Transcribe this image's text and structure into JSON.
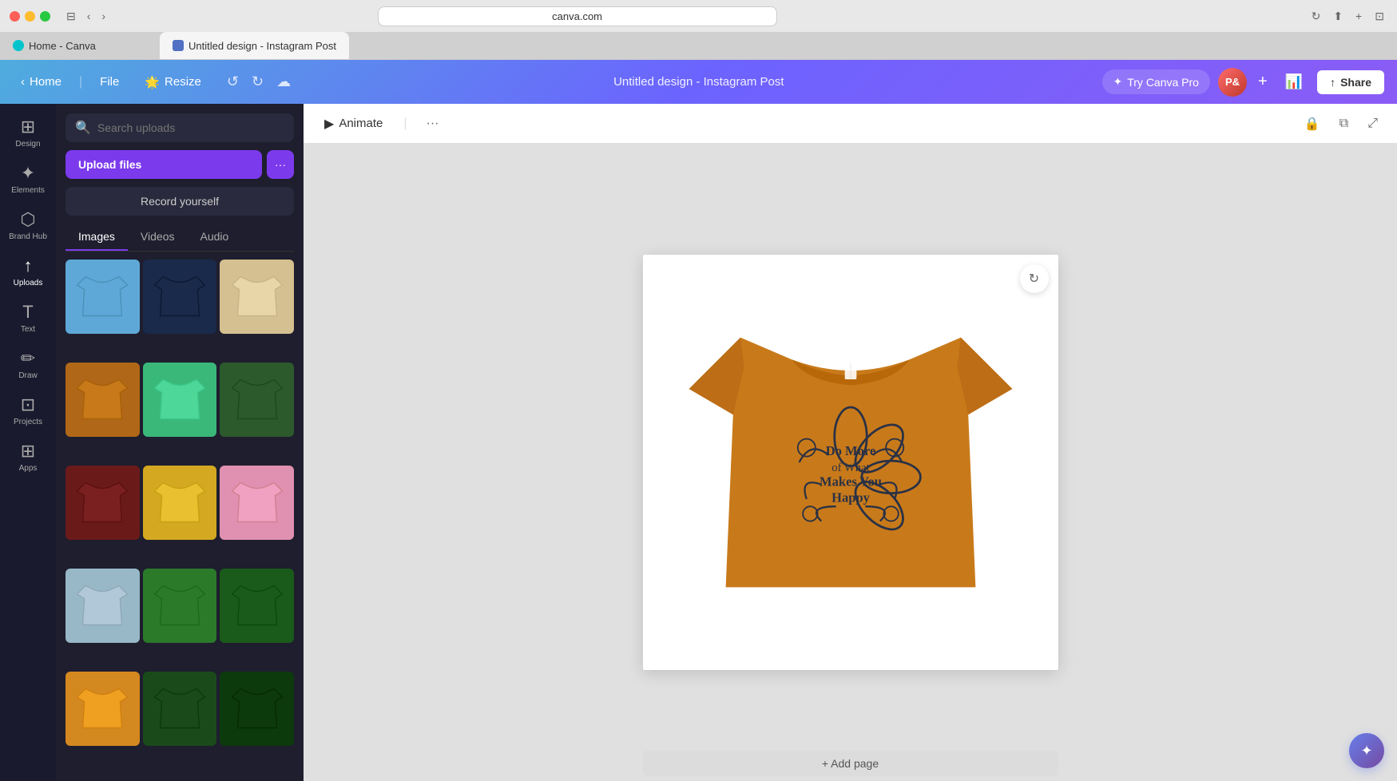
{
  "browser": {
    "url": "canva.com",
    "tabs": [
      {
        "label": "Home - Canva",
        "favicon_type": "canva-home",
        "active": false
      },
      {
        "label": "Untitled design - Instagram Post",
        "favicon_type": "canva-design",
        "active": true
      }
    ]
  },
  "nav": {
    "home_label": "Home",
    "file_label": "File",
    "resize_label": "Resize",
    "title": "Untitled design - Instagram Post",
    "try_pro_label": "Try Canva Pro",
    "avatar_label": "P&",
    "share_label": "Share"
  },
  "sidebar": {
    "items": [
      {
        "id": "design",
        "label": "Design",
        "icon": "⊞"
      },
      {
        "id": "elements",
        "label": "Elements",
        "icon": "✦"
      },
      {
        "id": "brand-hub",
        "label": "Brand Hub",
        "icon": "⬡"
      },
      {
        "id": "uploads",
        "label": "Uploads",
        "icon": "↑"
      },
      {
        "id": "text",
        "label": "Text",
        "icon": "T"
      },
      {
        "id": "draw",
        "label": "Draw",
        "icon": "✏"
      },
      {
        "id": "projects",
        "label": "Projects",
        "icon": "⊡"
      },
      {
        "id": "apps",
        "label": "Apps",
        "icon": "⊞"
      }
    ]
  },
  "uploads_panel": {
    "search_placeholder": "Search uploads",
    "upload_files_label": "Upload files",
    "upload_more_icon": "···",
    "record_label": "Record yourself",
    "tabs": [
      {
        "id": "images",
        "label": "Images",
        "active": true
      },
      {
        "id": "videos",
        "label": "Videos",
        "active": false
      },
      {
        "id": "audio",
        "label": "Audio",
        "active": false
      }
    ],
    "thumbnails": [
      {
        "color": "#5ea8d8",
        "label": "light-blue-tshirt"
      },
      {
        "color": "#1a2a4a",
        "label": "dark-navy-tshirt"
      },
      {
        "color": "#e8d5a8",
        "label": "beige-tshirt"
      },
      {
        "color": "#c87a1a",
        "label": "amber-tshirt"
      },
      {
        "color": "#4dd89a",
        "label": "mint-tshirt"
      },
      {
        "color": "#2d5a2d",
        "label": "dark-green-tshirt"
      },
      {
        "color": "#6b1a1a",
        "label": "maroon-tshirt"
      },
      {
        "color": "#f5c842",
        "label": "yellow-tshirt"
      },
      {
        "color": "#f0a0c0",
        "label": "pink-tshirt"
      },
      {
        "color": "#b0c8d8",
        "label": "light-blue2-tshirt"
      },
      {
        "color": "#2a7a2a",
        "label": "green-tshirt"
      },
      {
        "color": "#1a5a1a",
        "label": "forest-green-tshirt"
      },
      {
        "color": "#f0a020",
        "label": "orange-tshirt"
      },
      {
        "color": "#1a4a1a",
        "label": "deep-green-tshirt"
      },
      {
        "color": "#0d3a0d",
        "label": "darkest-green-tshirt"
      }
    ]
  },
  "canvas": {
    "animate_label": "Animate",
    "add_page_label": "+ Add page",
    "tshirt_color": "#c87a1a",
    "tshirt_text": "Do More of What Makes You Happy"
  },
  "icons": {
    "search": "🔍",
    "chevron_left": "‹",
    "chevron_right": "›",
    "undo": "↺",
    "redo": "↻",
    "cloud": "☁",
    "share": "↑",
    "star": "✦",
    "more": "···",
    "animate": "▶",
    "lock": "🔒",
    "copy": "⧉",
    "expand": "⤢",
    "refresh": "↻",
    "magic": "✦"
  }
}
